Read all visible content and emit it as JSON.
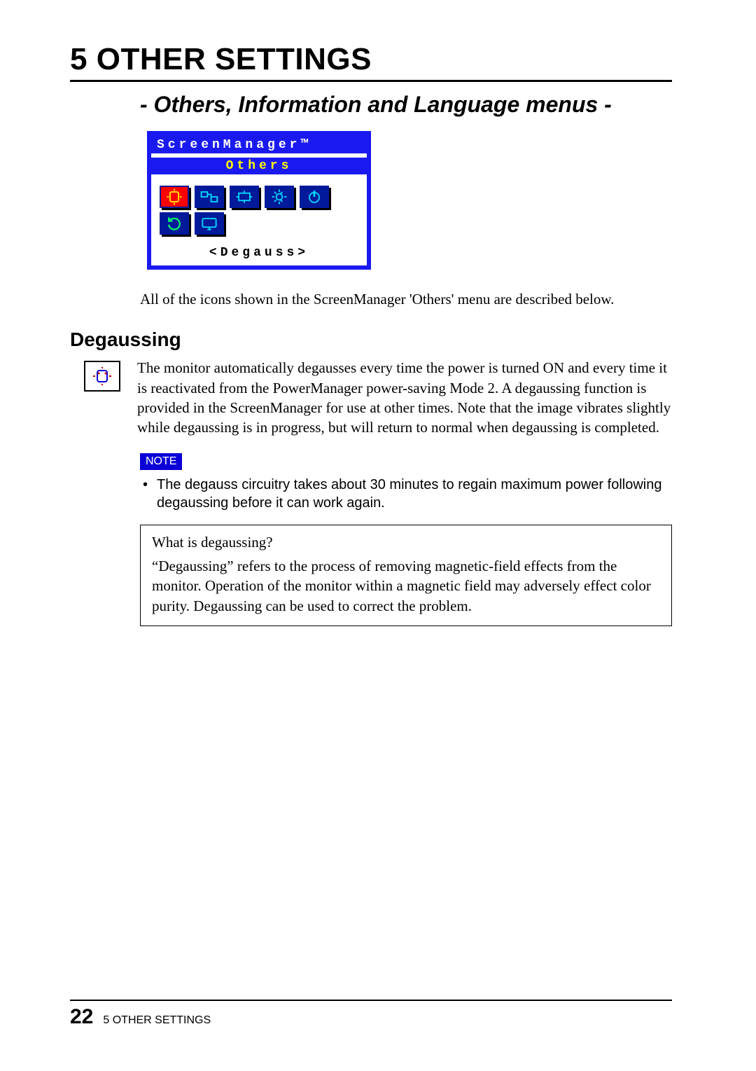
{
  "chapter": {
    "number": "5",
    "title": "OTHER SETTINGS"
  },
  "subtitle": "- Others, Information and Language menus -",
  "osd": {
    "title": "ScreenManager™",
    "submenu": "Others",
    "selected_item": "<Degauss>",
    "icons": [
      "degauss-icon",
      "input-icon",
      "position-icon",
      "brightness-icon",
      "power-icon",
      "refresh-icon",
      "monitor-icon"
    ]
  },
  "intro": "All of the icons shown in the ScreenManager 'Others' menu are described below.",
  "section": {
    "heading": "Degaussing",
    "body": "The monitor automatically degausses every time the power is turned ON and every time it is reactivated from the PowerManager power-saving Mode 2.  A degaussing function is provided in the ScreenManager for use at other times.  Note that the image vibrates slightly while degaussing is in progress, but will return to normal when degaussing is completed."
  },
  "note": {
    "label": "NOTE",
    "items": [
      "The degauss circuitry takes about 30 minutes to regain maximum power following degaussing before it can work again."
    ]
  },
  "infobox": {
    "q": "What is degaussing?",
    "a": "“Degaussing” refers to the process of removing magnetic-field effects from the monitor.  Operation of the monitor within a magnetic field may adversely effect color purity.  Degaussing can be used to correct the problem."
  },
  "footer": {
    "page": "22",
    "crumbs": "5   OTHER SETTINGS"
  }
}
